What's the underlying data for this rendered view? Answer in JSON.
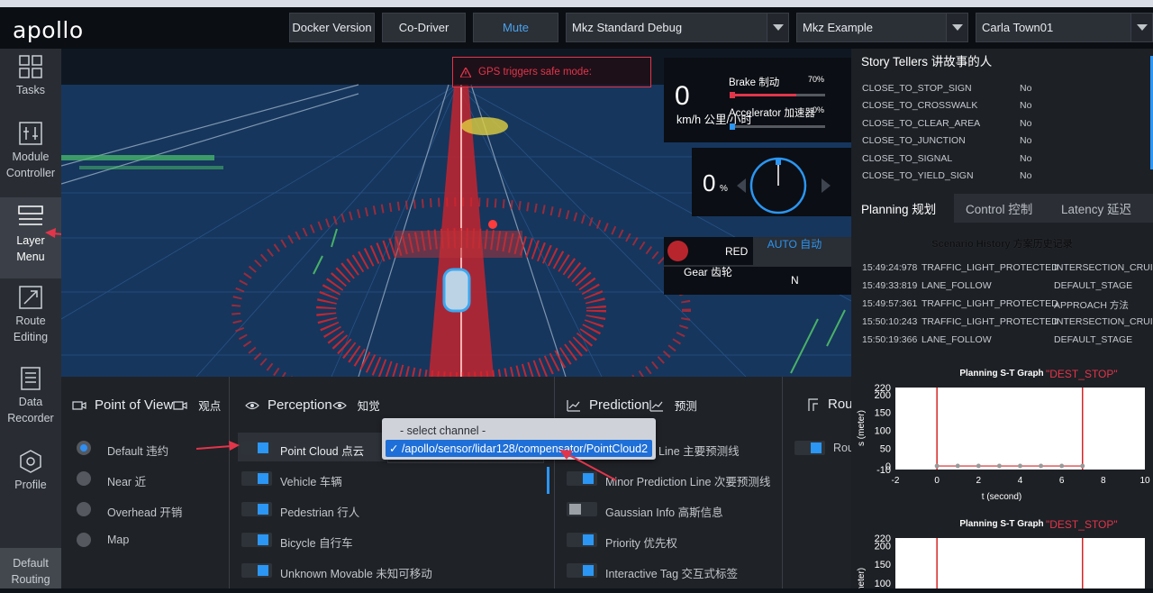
{
  "header": {
    "logo": "apollo",
    "docker_version": "Docker Version",
    "co_driver": "Co-Driver",
    "mute": "Mute",
    "mode_select": "Mkz Standard Debug",
    "vehicle_select": "Mkz Example",
    "map_select": "Carla Town01"
  },
  "sidebar": {
    "items": [
      {
        "label": "Tasks",
        "icon": "grid-icon"
      },
      {
        "label": "Module Controller",
        "icon": "sliders-icon"
      },
      {
        "label": "Layer Menu",
        "icon": "layers-icon"
      },
      {
        "label": "Route Editing",
        "icon": "route-icon"
      },
      {
        "label": "Data Recorder",
        "icon": "document-icon"
      },
      {
        "label": "Profile",
        "icon": "hexagon-icon"
      },
      {
        "label": "Default Routing",
        "icon": ""
      }
    ]
  },
  "viewport": {
    "warning": "GPS triggers safe mode:",
    "speed_value": "0",
    "speed_unit": "km/h 公里/小时",
    "brake_label": "Brake 制动",
    "brake_pct": "70%",
    "brake_level": 0.7,
    "accel_label": "Accelerator 加速器",
    "accel_pct": "0%",
    "steer_value": "0",
    "steer_unit": "%",
    "signal_text": "RED",
    "auto_text": "AUTO 自动",
    "gear_label": "Gear 齿轮",
    "gear_value": "N"
  },
  "panels": {
    "pov": {
      "title": "Point of View",
      "title_cn": "观点",
      "options": [
        "Default 违约",
        "Near 近",
        "Overhead 开销",
        "Map"
      ],
      "selected": 0
    },
    "perception": {
      "title": "Perception",
      "title_cn": "知觉",
      "items": [
        "Point Cloud 点云",
        "Vehicle 车辆",
        "Pedestrian 行人",
        "Bicycle 自行车",
        "Unknown Movable 未知可移动"
      ]
    },
    "prediction": {
      "title": "Prediction",
      "title_cn": "预测",
      "items": [
        "Prediction Line 主要预测线",
        "Minor Prediction Line 次要预测线",
        "Gaussian Info 高斯信息",
        "Priority 优先权",
        "Interactive Tag 交互式标签"
      ]
    },
    "routing": {
      "title": "Rou",
      "item": "Rou"
    }
  },
  "dropdown": {
    "placeholder": "- select channel -",
    "selected": "✓ /apollo/sensor/lidar128/compensator/PointCloud2"
  },
  "story_tellers": {
    "title": "Story Tellers 讲故事的人",
    "rows": [
      {
        "name": "CLOSE_TO_STOP_SIGN",
        "value": "No"
      },
      {
        "name": "CLOSE_TO_CROSSWALK",
        "value": "No"
      },
      {
        "name": "CLOSE_TO_CLEAR_AREA",
        "value": "No"
      },
      {
        "name": "CLOSE_TO_JUNCTION",
        "value": "No"
      },
      {
        "name": "CLOSE_TO_SIGNAL",
        "value": "No"
      },
      {
        "name": "CLOSE_TO_YIELD_SIGN",
        "value": "No"
      }
    ]
  },
  "tabs": [
    "Planning 规划",
    "Control 控制",
    "Latency 延迟"
  ],
  "scenario_history": {
    "title": "Scenario History 方案历史记录",
    "rows": [
      {
        "time": "15:49:24:978",
        "scenario": "TRAFFIC_LIGHT_PROTECTED",
        "stage": "INTERSECTION_CRUISE"
      },
      {
        "time": "15:49:33:819",
        "scenario": "LANE_FOLLOW",
        "stage": "DEFAULT_STAGE"
      },
      {
        "time": "15:49:57:361",
        "scenario": "TRAFFIC_LIGHT_PROTECTED",
        "stage": "APPROACH 方法"
      },
      {
        "time": "15:50:10:243",
        "scenario": "TRAFFIC_LIGHT_PROTECTED",
        "stage": "INTERSECTION_CRUISE"
      },
      {
        "time": "15:50:19:366",
        "scenario": "LANE_FOLLOW",
        "stage": "DEFAULT_STAGE"
      }
    ]
  },
  "chart_data": [
    {
      "type": "line",
      "title": "Planning S-T Graph",
      "annotation": "\"DEST_STOP\"",
      "xlabel": "t (second)",
      "ylabel": "s (meter)",
      "xlim": [
        -2,
        10
      ],
      "ylim": [
        -10,
        220
      ],
      "xticks": [
        "-2",
        "0",
        "2",
        "4",
        "6",
        "8",
        "10"
      ],
      "yticks": [
        "220",
        "200",
        "150",
        "100",
        "50",
        "0",
        "-10"
      ],
      "x": [
        0,
        1,
        2,
        3,
        4,
        5,
        6,
        7
      ],
      "y": [
        0,
        0,
        0,
        0,
        0,
        0,
        0,
        0
      ],
      "boundaries_x": [
        0,
        7
      ]
    },
    {
      "type": "line",
      "title": "Planning S-T Graph",
      "annotation": "\"DEST_STOP\"",
      "ylabel": "(meter)",
      "yticks": [
        "220",
        "200",
        "150",
        "100"
      ],
      "boundaries_x": [
        0,
        7
      ]
    }
  ],
  "colors": {
    "accent": "#2b96f3",
    "warning": "#e2354a",
    "viewport_bg": "#143256"
  }
}
